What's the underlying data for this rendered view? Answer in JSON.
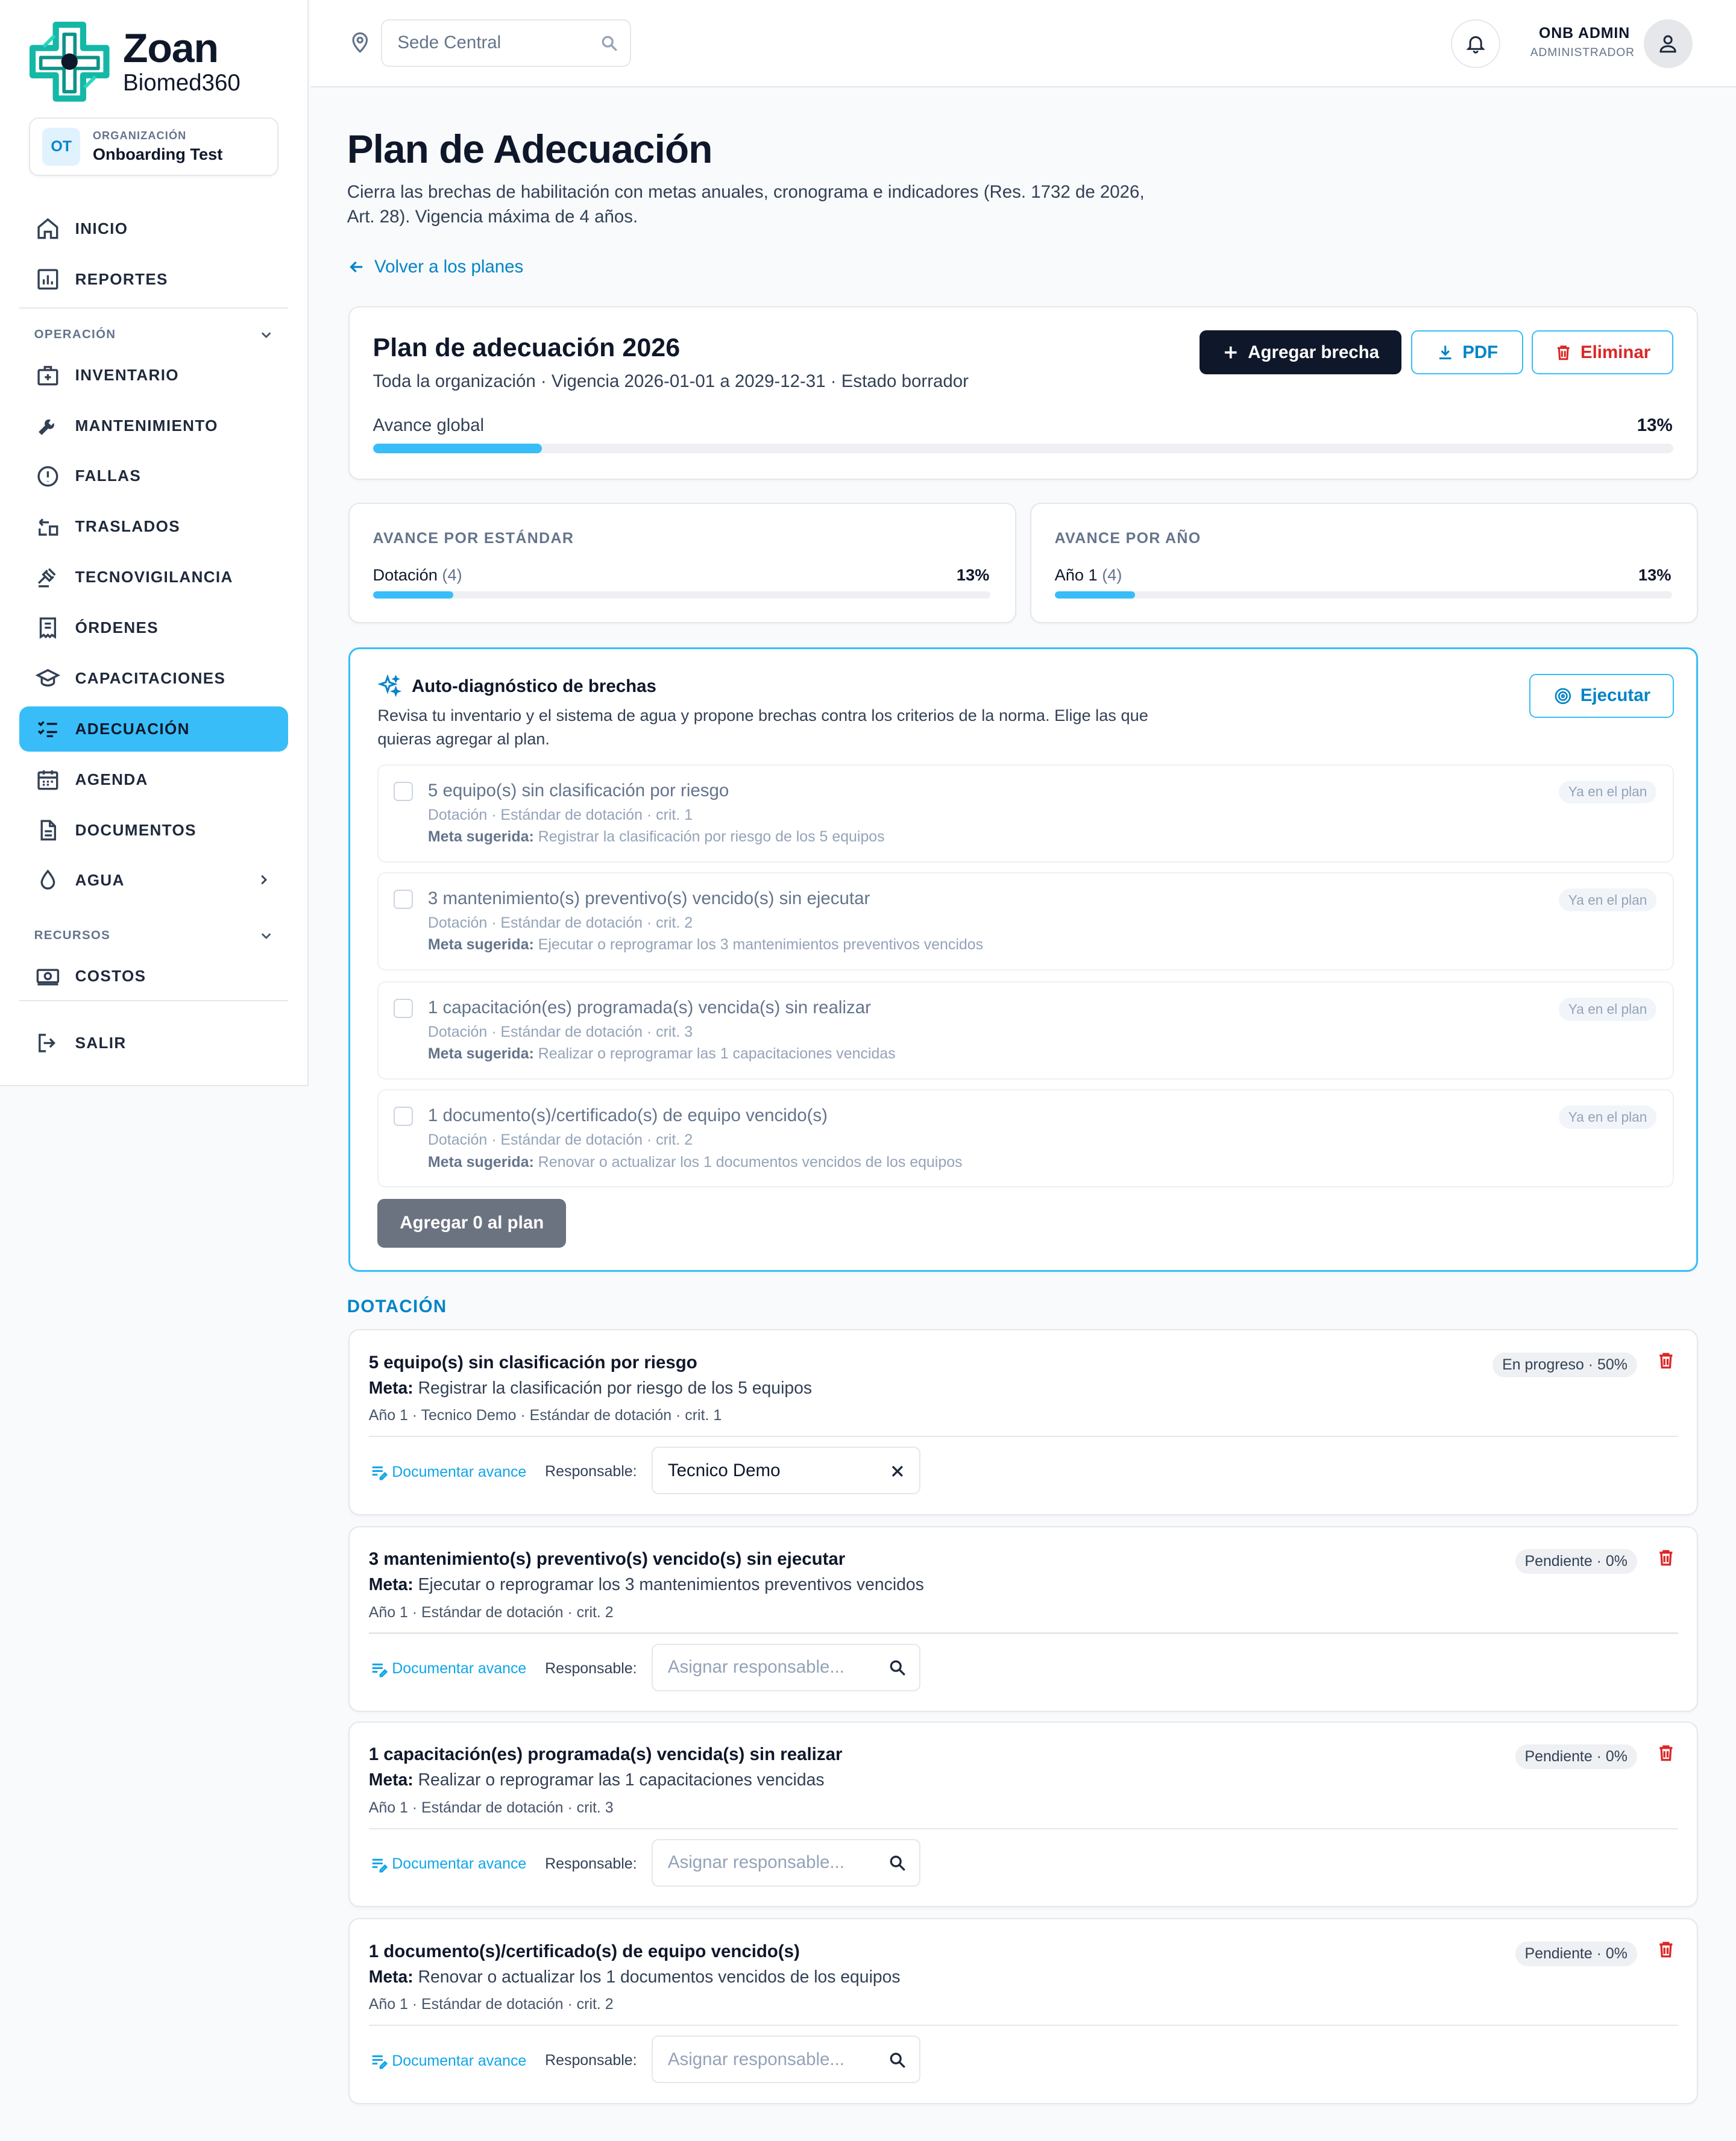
{
  "brand": {
    "name": "Zoan",
    "sub": "Biomed360"
  },
  "org": {
    "badge": "OT",
    "label": "ORGANIZACIÓN",
    "name": "Onboarding Test"
  },
  "nav": {
    "inicio": "INICIO",
    "reportes": "REPORTES",
    "section_operacion": "OPERACIÓN",
    "inventario": "INVENTARIO",
    "mantenimiento": "MANTENIMIENTO",
    "fallas": "FALLAS",
    "traslados": "TRASLADOS",
    "tecnovigilancia": "TECNOVIGILANCIA",
    "ordenes": "ÓRDENES",
    "capacitaciones": "CAPACITACIONES",
    "adecuacion": "ADECUACIÓN",
    "agenda": "AGENDA",
    "documentos": "DOCUMENTOS",
    "agua": "AGUA",
    "section_recursos": "RECURSOS",
    "costos": "COSTOS",
    "salir": "SALIR"
  },
  "topbar": {
    "site_placeholder": "Sede Central",
    "user_name": "ONB ADMIN",
    "user_role": "ADMINISTRADOR"
  },
  "page": {
    "title": "Plan de Adecuación",
    "description": "Cierra las brechas de habilitación con metas anuales, cronograma e indicadores (Res. 1732 de 2026, Art. 28). Vigencia máxima de 4 años.",
    "back": "Volver a los planes"
  },
  "plan": {
    "title": "Plan de adecuación 2026",
    "meta": "Toda la organización · Vigencia 2026-01-01 a 2029-12-31 · Estado borrador",
    "add_button": "Agregar brecha",
    "pdf_button": "PDF",
    "delete_button": "Eliminar",
    "progress_label": "Avance global",
    "progress_pct": "13%",
    "progress_value": 13
  },
  "stats": {
    "by_standard": {
      "header": "AVANCE POR ESTÁNDAR",
      "label": "Dotación",
      "count": "(4)",
      "pct": "13%",
      "value": 13
    },
    "by_year": {
      "header": "AVANCE POR AÑO",
      "label": "Año 1",
      "count": "(4)",
      "pct": "13%",
      "value": 13
    }
  },
  "diagnostic": {
    "title": "Auto-diagnóstico de brechas",
    "description": "Revisa tu inventario y el sistema de agua y propone brechas contra los criterios de la norma. Elige las que quieras agregar al plan.",
    "run_button": "Ejecutar",
    "meta_label": "Meta sugerida:",
    "badge": "Ya en el plan",
    "add_button": "Agregar 0 al plan",
    "items": [
      {
        "title": "5 equipo(s) sin clasificación por riesgo",
        "sub": "Dotación · Estándar de dotación · crit. 1",
        "goal": "Registrar la clasificación por riesgo de los 5 equipos"
      },
      {
        "title": "3 mantenimiento(s) preventivo(s) vencido(s) sin ejecutar",
        "sub": "Dotación · Estándar de dotación · crit. 2",
        "goal": "Ejecutar o reprogramar los 3 mantenimientos preventivos vencidos"
      },
      {
        "title": "1 capacitación(es) programada(s) vencida(s) sin realizar",
        "sub": "Dotación · Estándar de dotación · crit. 3",
        "goal": "Realizar o reprogramar las 1 capacitaciones vencidas"
      },
      {
        "title": "1 documento(s)/certificado(s) de equipo vencido(s)",
        "sub": "Dotación · Estándar de dotación · crit. 2",
        "goal": "Renovar o actualizar los 1 documentos vencidos de los equipos"
      }
    ]
  },
  "section": {
    "title": "DOTACIÓN"
  },
  "gaps": {
    "meta_label": "Meta:",
    "doc_link": "Documentar avance",
    "resp_label": "Responsable:",
    "resp_placeholder": "Asignar responsable...",
    "items": [
      {
        "title": "5 equipo(s) sin clasificación por riesgo",
        "goal": "Registrar la clasificación por riesgo de los 5 equipos",
        "sub": "Año 1 · Tecnico Demo · Estándar de dotación · crit. 1",
        "status": "En progreso · 50%",
        "responsible": "Tecnico Demo"
      },
      {
        "title": "3 mantenimiento(s) preventivo(s) vencido(s) sin ejecutar",
        "goal": "Ejecutar o reprogramar los 3 mantenimientos preventivos vencidos",
        "sub": "Año 1 · Estándar de dotación · crit. 2",
        "status": "Pendiente · 0%",
        "responsible": ""
      },
      {
        "title": "1 capacitación(es) programada(s) vencida(s) sin realizar",
        "goal": "Realizar o reprogramar las 1 capacitaciones vencidas",
        "sub": "Año 1 · Estándar de dotación · crit. 3",
        "status": "Pendiente · 0%",
        "responsible": ""
      },
      {
        "title": "1 documento(s)/certificado(s) de equipo vencido(s)",
        "goal": "Renovar o actualizar los 1 documentos vencidos de los equipos",
        "sub": "Año 1 · Estándar de dotación · crit. 2",
        "status": "Pendiente · 0%",
        "responsible": ""
      }
    ]
  },
  "colors": {
    "accent": "#38bdf8",
    "brand_teal": "#14b8a6",
    "dark": "#0f172a",
    "danger": "#dc2626"
  }
}
